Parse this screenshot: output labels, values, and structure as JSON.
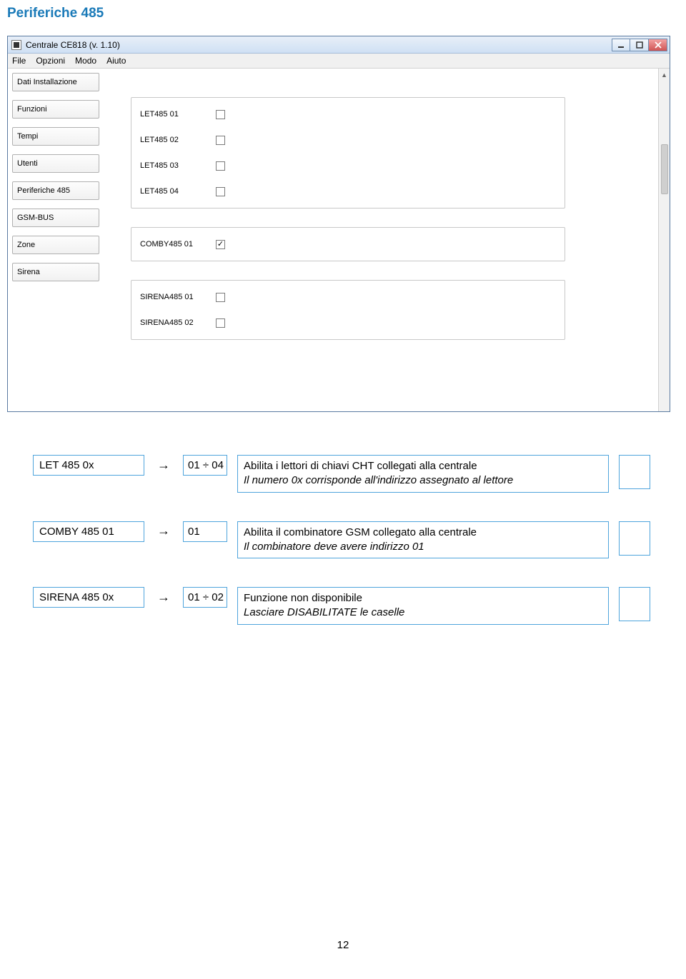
{
  "page_title": "Periferiche 485",
  "page_number": "12",
  "window": {
    "title": "Centrale CE818 (v. 1.10)",
    "menu": [
      "File",
      "Opzioni",
      "Modo",
      "Aiuto"
    ]
  },
  "sidebar_items": [
    "Dati Installazione",
    "Funzioni",
    "Tempi",
    "Utenti",
    "Periferiche 485",
    "GSM-BUS",
    "Zone",
    "Sirena"
  ],
  "group1": [
    {
      "label": "LET485 01",
      "checked": false
    },
    {
      "label": "LET485 02",
      "checked": false
    },
    {
      "label": "LET485 03",
      "checked": false
    },
    {
      "label": "LET485 04",
      "checked": false
    }
  ],
  "group2": [
    {
      "label": "COMBY485 01",
      "checked": true
    }
  ],
  "group3": [
    {
      "label": "SIRENA485 01",
      "checked": false
    },
    {
      "label": "SIRENA485 02",
      "checked": false
    }
  ],
  "desc": [
    {
      "name": "LET 485 0x",
      "range": "01 ÷ 04",
      "main": "Abilita i lettori di chiavi CHT collegati alla centrale",
      "note": "Il numero 0x corrisponde all'indirizzo assegnato al lettore"
    },
    {
      "name": "COMBY 485 01",
      "range": "01",
      "main": "Abilita il combinatore GSM collegato alla centrale",
      "note": "Il combinatore deve avere indirizzo 01"
    },
    {
      "name": "SIRENA 485 0x",
      "range": "01 ÷ 02",
      "main": "Funzione non disponibile",
      "note": "Lasciare DISABILITATE le caselle"
    }
  ]
}
